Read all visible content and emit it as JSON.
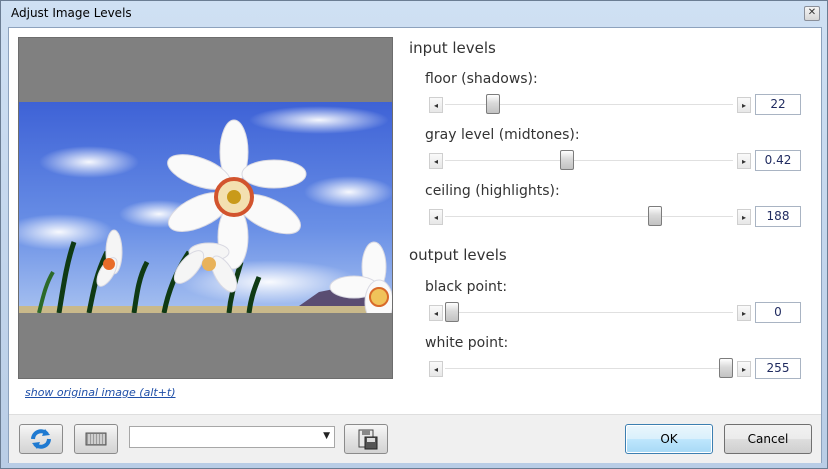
{
  "window": {
    "title": "Adjust Image Levels"
  },
  "preview": {
    "show_original_link": "show original image (alt+t)"
  },
  "input_levels": {
    "heading": "input levels",
    "sliders": [
      {
        "label": "floor (shadows):",
        "value": "22",
        "fraction": 0.15
      },
      {
        "label": "gray level (midtones):",
        "value": "0.42",
        "fraction": 0.42
      },
      {
        "label": "ceiling (highlights):",
        "value": "188",
        "fraction": 0.74
      }
    ]
  },
  "output_levels": {
    "heading": "output levels",
    "sliders": [
      {
        "label": "black point:",
        "value": "0",
        "fraction": 0.0
      },
      {
        "label": "white point:",
        "value": "255",
        "fraction": 1.0
      }
    ]
  },
  "footer": {
    "preset_value": "",
    "ok_label": "OK",
    "cancel_label": "Cancel"
  },
  "icons": [
    "refresh-icon",
    "histogram-icon",
    "save-icon",
    "left-arrow-icon",
    "right-arrow-icon"
  ],
  "colors": {
    "accent": "#3c7fb1",
    "link": "#1f4fa8"
  }
}
